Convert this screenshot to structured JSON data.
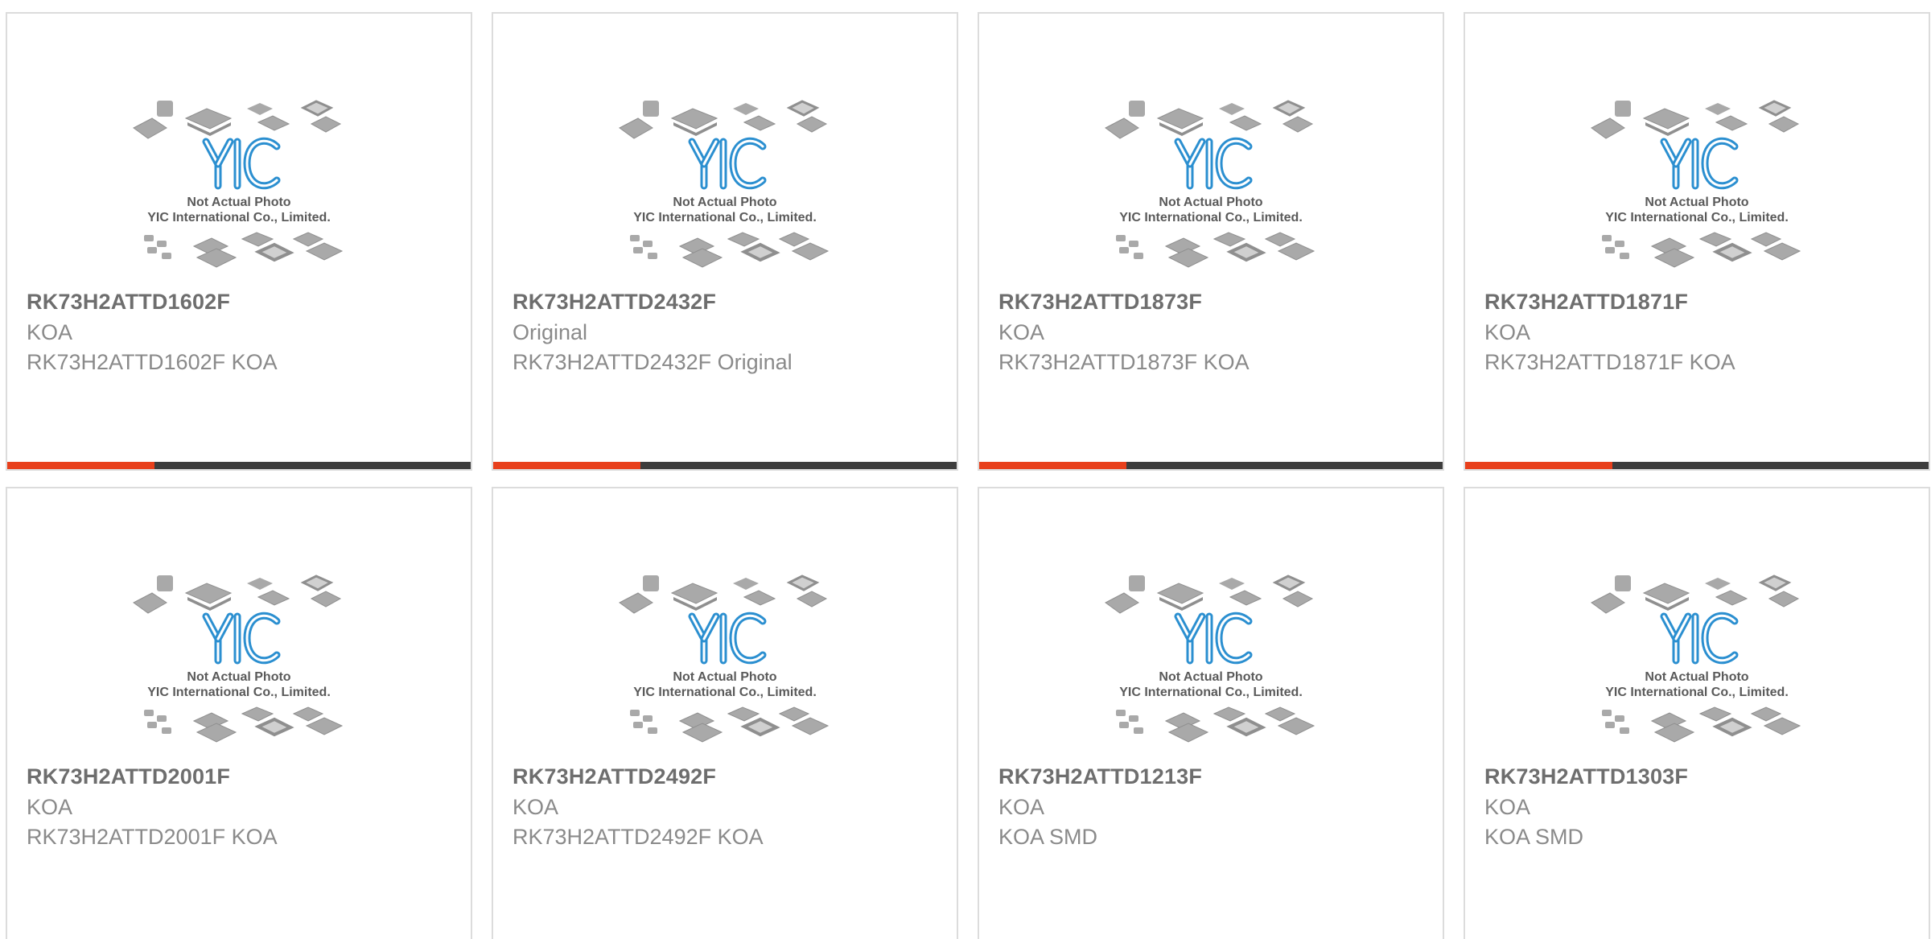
{
  "placeholder": {
    "line1": "Not Actual Photo",
    "line2": "YIC International Co., Limited.",
    "logo": "YIC"
  },
  "colors": {
    "accent": "#e8401c",
    "bar": "#3d3d3d",
    "logo_blue": "#2b8fd0"
  },
  "products": [
    {
      "part": "RK73H2ATTD1602F",
      "brand": "KOA",
      "desc": "RK73H2ATTD1602F KOA"
    },
    {
      "part": "RK73H2ATTD2432F",
      "brand": "Original",
      "desc": "RK73H2ATTD2432F Original"
    },
    {
      "part": "RK73H2ATTD1873F",
      "brand": "KOA",
      "desc": "RK73H2ATTD1873F KOA"
    },
    {
      "part": "RK73H2ATTD1871F",
      "brand": "KOA",
      "desc": "RK73H2ATTD1871F KOA"
    },
    {
      "part": "RK73H2ATTD2001F",
      "brand": "KOA",
      "desc": "RK73H2ATTD2001F KOA"
    },
    {
      "part": "RK73H2ATTD2492F",
      "brand": "KOA",
      "desc": "RK73H2ATTD2492F KOA"
    },
    {
      "part": "RK73H2ATTD1213F",
      "brand": "KOA",
      "desc": "KOA SMD"
    },
    {
      "part": "RK73H2ATTD1303F",
      "brand": "KOA",
      "desc": "KOA SMD"
    }
  ]
}
